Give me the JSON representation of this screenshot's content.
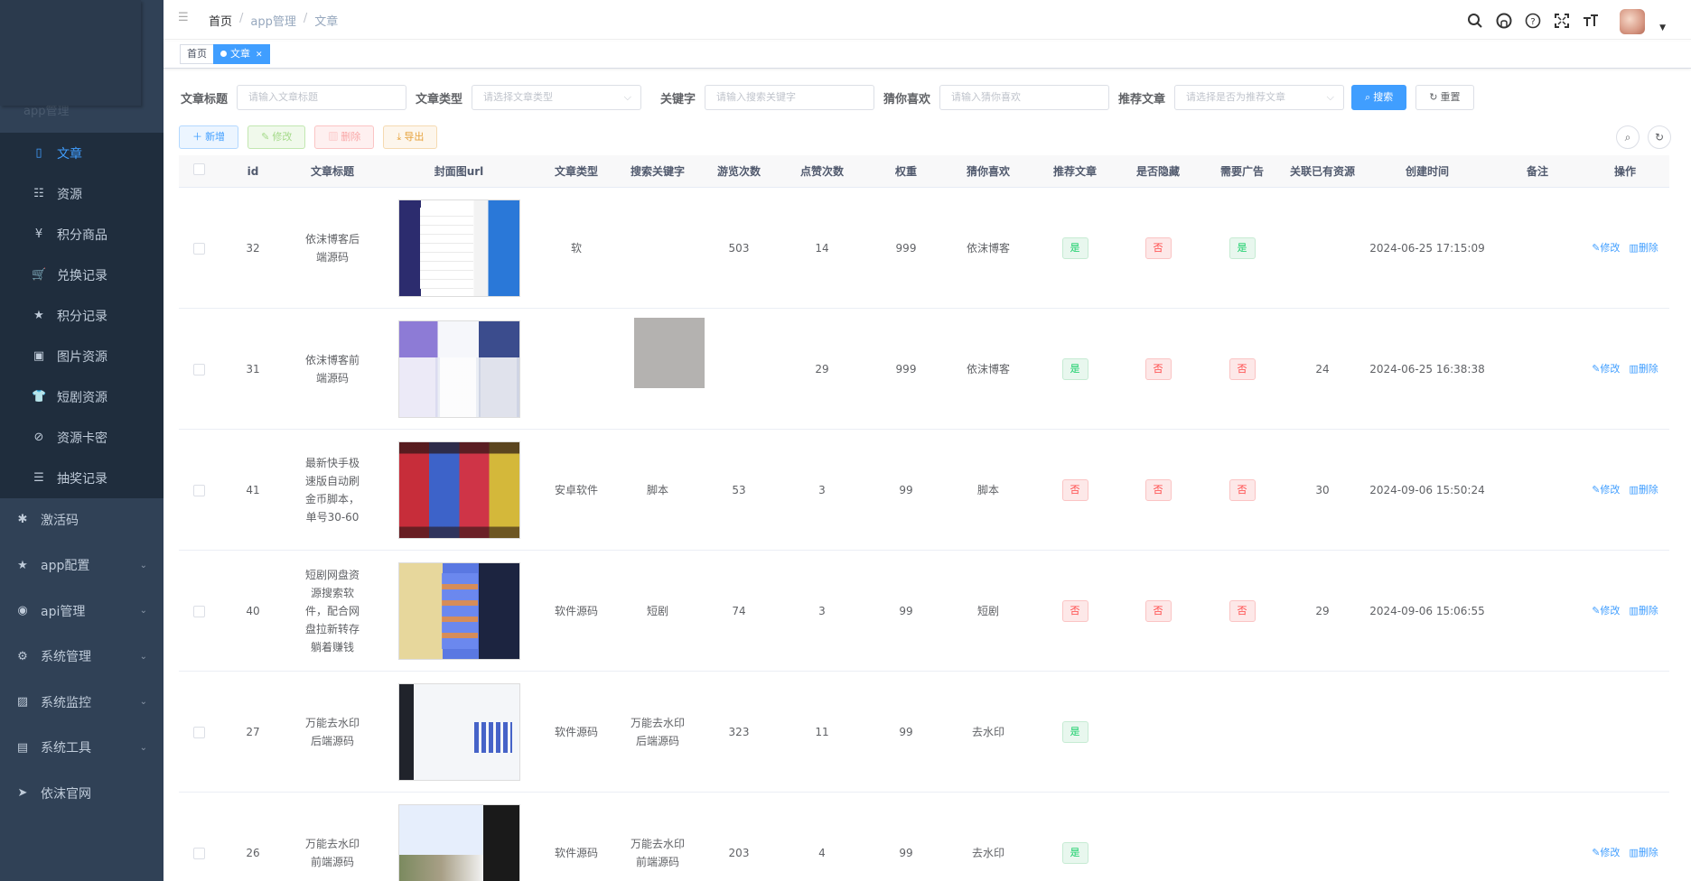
{
  "sidebar": {
    "faded_group_label": "app管理",
    "sub_items": [
      {
        "icon": "book-icon",
        "glyph": "▯",
        "label": "文章"
      },
      {
        "icon": "resource-icon",
        "glyph": "☷",
        "label": "资源"
      },
      {
        "icon": "yen-icon",
        "glyph": "¥",
        "label": "积分商品"
      },
      {
        "icon": "cart-icon",
        "glyph": "🛒",
        "label": "兑换记录"
      },
      {
        "icon": "star-icon",
        "glyph": "★",
        "label": "积分记录"
      },
      {
        "icon": "picture-icon",
        "glyph": "▣",
        "label": "图片资源"
      },
      {
        "icon": "shirt-icon",
        "glyph": "👕",
        "label": "短剧资源"
      },
      {
        "icon": "card-icon",
        "glyph": "⊘",
        "label": "资源卡密"
      },
      {
        "icon": "list-icon",
        "glyph": "☰",
        "label": "抽奖记录"
      }
    ],
    "top_items": [
      {
        "icon": "bug-icon",
        "glyph": "✱",
        "label": "激活码",
        "arrow": ""
      },
      {
        "icon": "star-icon",
        "glyph": "★",
        "label": "app配置",
        "arrow": "⌄"
      },
      {
        "icon": "globe-icon",
        "glyph": "◉",
        "label": "api管理",
        "arrow": "⌄"
      },
      {
        "icon": "gear-icon",
        "glyph": "⚙",
        "label": "系统管理",
        "arrow": "⌄"
      },
      {
        "icon": "monitor-icon",
        "glyph": "▨",
        "label": "系统监控",
        "arrow": "⌄"
      },
      {
        "icon": "toolbox-icon",
        "glyph": "▤",
        "label": "系统工具",
        "arrow": "⌄"
      },
      {
        "icon": "send-icon",
        "glyph": "➤",
        "label": "依沫官网",
        "arrow": ""
      }
    ]
  },
  "navbar": {
    "breadcrumb": [
      "首页",
      "app管理",
      "文章"
    ],
    "separator": "/"
  },
  "tags": {
    "home": "首页",
    "active": "文章"
  },
  "filters": {
    "title_label": "文章标题",
    "title_placeholder": "请输入文章标题",
    "type_label": "文章类型",
    "type_placeholder": "请选择文章类型",
    "keyword_label": "关键字",
    "keyword_placeholder": "请输入搜索关键字",
    "guess_label": "猜你喜欢",
    "guess_placeholder": "请输入猜你喜欢",
    "recommend_label": "推荐文章",
    "recommend_placeholder": "请选择是否为推荐文章",
    "search_button": "搜索",
    "reset_button": "重置"
  },
  "toolbar": {
    "add": "新增",
    "edit": "修改",
    "delete": "删除",
    "export": "导出"
  },
  "table": {
    "headers": [
      "id",
      "文章标题",
      "封面图url",
      "文章类型",
      "搜索关键字",
      "游览次数",
      "点赞次数",
      "权重",
      "猜你喜欢",
      "推荐文章",
      "是否隐藏",
      "需要广告",
      "关联已有资源",
      "创建时间",
      "备注",
      "操作"
    ],
    "yes": "是",
    "no": "否",
    "edit_op": "修改",
    "delete_op": "删除",
    "rows": [
      {
        "id": "32",
        "title": "依沫博客后端源码",
        "type": "软",
        "keyword": "",
        "views": "503",
        "likes": "14",
        "weight": "999",
        "guess": "依沫博客",
        "recommend": "是",
        "hidden": "否",
        "ad": "是",
        "related": "",
        "created": "2024-06-25 17:15:09"
      },
      {
        "id": "31",
        "title": "依沫博客前端源码",
        "type": "",
        "keyword": "",
        "views": "",
        "likes": "29",
        "weight": "999",
        "guess": "依沫博客",
        "recommend": "是",
        "hidden": "否",
        "ad": "否",
        "related": "24",
        "created": "2024-06-25 16:38:38"
      },
      {
        "id": "41",
        "title": "最新快手极速版自动刷金币脚本，单号30-60",
        "type": "安卓软件",
        "keyword": "脚本",
        "views": "53",
        "likes": "3",
        "weight": "99",
        "guess": "脚本",
        "recommend": "否",
        "hidden": "否",
        "ad": "否",
        "related": "30",
        "created": "2024-09-06 15:50:24"
      },
      {
        "id": "40",
        "title": "短剧网盘资源搜索软件，配合网盘拉新转存躺着赚钱",
        "type": "软件源码",
        "keyword": "短剧",
        "views": "74",
        "likes": "3",
        "weight": "99",
        "guess": "短剧",
        "recommend": "否",
        "hidden": "否",
        "ad": "否",
        "related": "29",
        "created": "2024-09-06 15:06:55"
      },
      {
        "id": "27",
        "title": "万能去水印后端源码",
        "type": "软件源码",
        "keyword": "万能去水印后端源码",
        "views": "323",
        "likes": "11",
        "weight": "99",
        "guess": "去水印",
        "recommend": "是",
        "hidden": "",
        "ad": "",
        "related": "",
        "created": ""
      },
      {
        "id": "26",
        "title": "万能去水印前端源码",
        "type": "软件源码",
        "keyword": "万能去水印前端源码",
        "views": "203",
        "likes": "4",
        "weight": "99",
        "guess": "去水印",
        "recommend": "是",
        "hidden": "",
        "ad": "",
        "related": "",
        "created": ""
      }
    ]
  }
}
